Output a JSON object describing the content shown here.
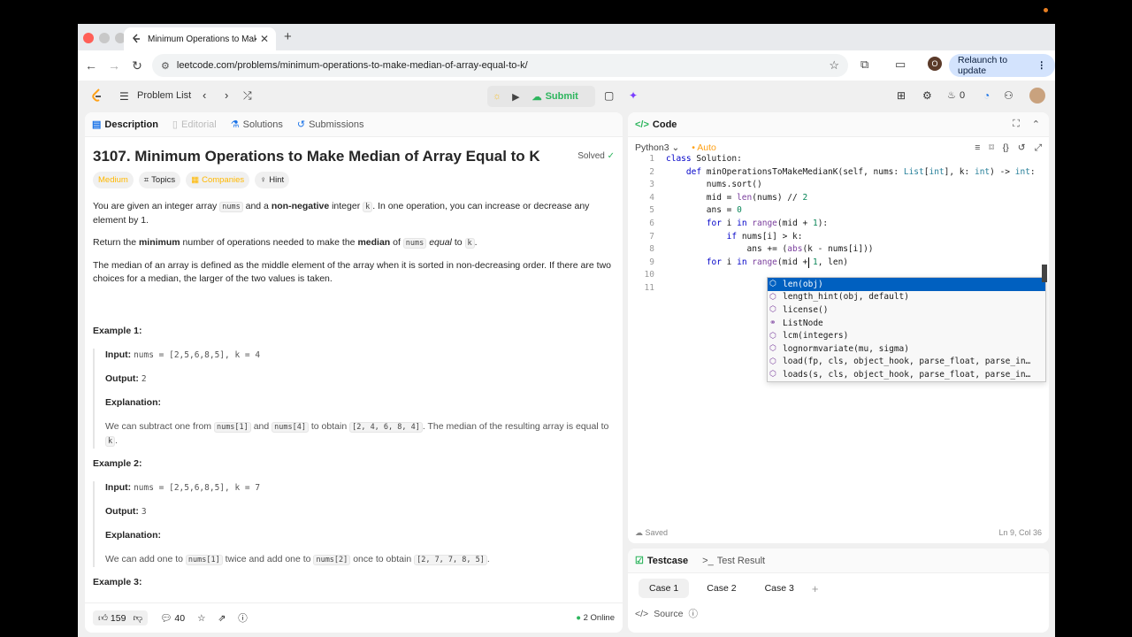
{
  "browser": {
    "tab_title": "Minimum Operations to Make",
    "url": "leetcode.com/problems/minimum-operations-to-make-median-of-array-equal-to-k/",
    "profile_initial": "O",
    "relaunch_label": "Relaunch to update"
  },
  "lc_nav": {
    "problem_list": "Problem List",
    "submit": "Submit",
    "streak": "0"
  },
  "left_tabs": [
    "Description",
    "Editorial",
    "Solutions",
    "Submissions"
  ],
  "problem": {
    "title": "3107. Minimum Operations to Make Median of Array Equal to K",
    "solved": "Solved",
    "difficulty": "Medium",
    "topics": "Topics",
    "companies": "Companies",
    "hint": "Hint",
    "p1a": "You are given an integer array ",
    "p1b": " and a ",
    "p1c": "non-negative",
    "p1d": " integer ",
    "p1e": ". In one operation, you can increase or decrease any element by 1.",
    "p2a": "Return the ",
    "p2b": "minimum",
    "p2c": " number of operations needed to make the ",
    "p2d": "median",
    "p2e": " of ",
    "p2f": "equal",
    "p2g": " to ",
    "p3": "The median of an array is defined as the middle element of the array when it is sorted in non-decreasing order. If there are two choices for a median, the larger of the two values is taken.",
    "code_nums": "nums",
    "code_k": "k"
  },
  "examples": [
    {
      "header": "Example 1:",
      "input_label": "Input:",
      "input": "nums = [2,5,6,8,5], k = 4",
      "output_label": "Output:",
      "output": "2",
      "expl_label": "Explanation:",
      "e1": "We can subtract one from ",
      "c1": "nums[1]",
      "e2": " and ",
      "c2": "nums[4]",
      "e3": " to obtain ",
      "c3": "[2, 4, 6, 8, 4]",
      "e4": ". The median of the resulting array is equal to ",
      "c4": "k",
      "e5": "."
    },
    {
      "header": "Example 2:",
      "input_label": "Input:",
      "input": "nums = [2,5,6,8,5], k = 7",
      "output_label": "Output:",
      "output": "3",
      "expl_label": "Explanation:",
      "e1": "We can add one to ",
      "c1": "nums[1]",
      "e2": " twice and add one to ",
      "c2": "nums[2]",
      "e3": " once to obtain ",
      "c3": "[2, 7, 7, 8, 5]",
      "e4": "."
    },
    {
      "header": "Example 3:"
    }
  ],
  "left_footer": {
    "likes": "159",
    "comments": "40",
    "online": "2 Online"
  },
  "code_panel": {
    "title": "Code",
    "language": "Python3",
    "auto": "Auto",
    "saved": "Saved",
    "cursor": "Ln 9, Col 36"
  },
  "code_lines": [
    "class Solution:",
    "    def minOperationsToMakeMedianK(self, nums: List[int], k: int) -> int:",
    "        nums.sort()",
    "        mid = len(nums) // 2",
    "        ans = 0",
    "        for i in range(mid + 1):",
    "            if nums[i] > k:",
    "                ans += (abs(k - nums[i]))",
    "        for i in range(mid + 1, len)",
    "",
    ""
  ],
  "autocomplete": [
    "len(obj)",
    "length_hint(obj, default)",
    "license()",
    "ListNode",
    "lcm(integers)",
    "lognormvariate(mu, sigma)",
    "load(fp, cls, object_hook, parse_float, parse_in…",
    "loads(s, cls, object_hook, parse_float, parse_in…"
  ],
  "testcase": {
    "tab1": "Testcase",
    "tab2": "Test Result",
    "cases": [
      "Case 1",
      "Case 2",
      "Case 3"
    ],
    "source": "Source"
  },
  "colors": {
    "accent_green": "#2db55d",
    "difficulty": "#ffb800",
    "selection_blue": "#0060c0"
  }
}
